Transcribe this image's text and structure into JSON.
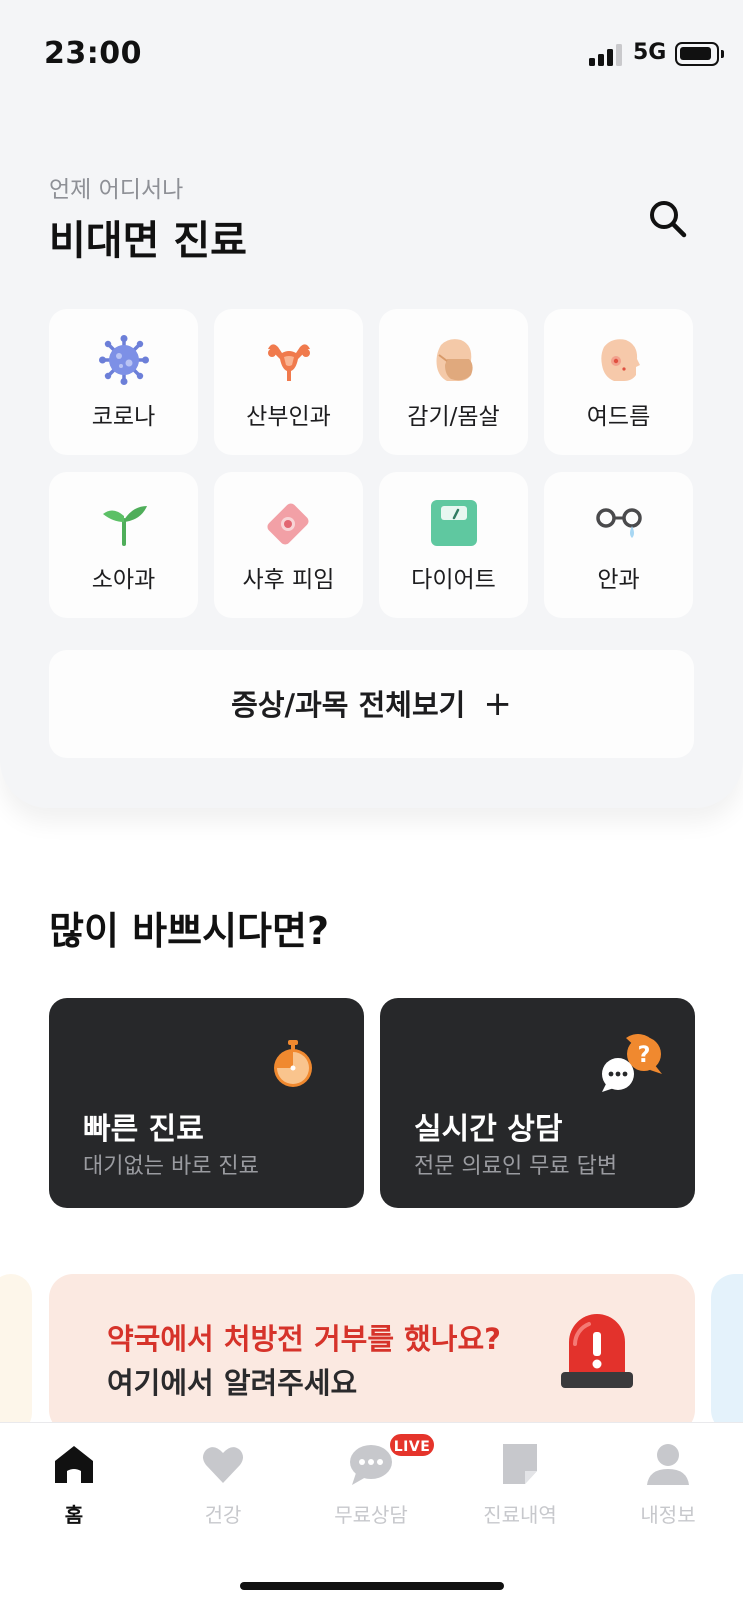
{
  "status_bar": {
    "time": "23:00",
    "network": "5G"
  },
  "header": {
    "subtitle": "언제 어디서나",
    "title": "비대면 진료"
  },
  "categories": [
    {
      "label": "코로나",
      "icon": "virus-icon"
    },
    {
      "label": "산부인과",
      "icon": "uterus-icon"
    },
    {
      "label": "감기/몸살",
      "icon": "mask-face-icon"
    },
    {
      "label": "여드름",
      "icon": "acne-face-icon"
    },
    {
      "label": "소아과",
      "icon": "sprout-icon"
    },
    {
      "label": "사후 피임",
      "icon": "pill-pack-icon"
    },
    {
      "label": "다이어트",
      "icon": "scale-icon"
    },
    {
      "label": "안과",
      "icon": "glasses-icon"
    }
  ],
  "view_all": {
    "label": "증상/과목 전체보기",
    "plus": "+"
  },
  "busy_section": {
    "title": "많이 바쁘시다면?",
    "cards": [
      {
        "title": "빠른 진료",
        "subtitle": "대기없는 바로 진료",
        "icon": "stopwatch-icon"
      },
      {
        "title": "실시간 상담",
        "subtitle": "전문 의료인 무료 답변",
        "icon": "chat-question-icon"
      }
    ]
  },
  "banner": {
    "line1": "약국에서 처방전 거부를 했나요?",
    "line2": "여기에서 알려주세요",
    "icon": "siren-icon"
  },
  "bottom_nav": {
    "items": [
      {
        "label": "홈",
        "icon": "home-icon",
        "active": true
      },
      {
        "label": "건강",
        "icon": "heart-icon",
        "active": false
      },
      {
        "label": "무료상담",
        "icon": "chat-bubble-icon",
        "active": false
      },
      {
        "label": "진료내역",
        "icon": "document-icon",
        "active": false
      },
      {
        "label": "내정보",
        "icon": "person-icon",
        "active": false
      }
    ],
    "live_badge": "LIVE"
  },
  "colors": {
    "panel_bg": "#f4f5f7",
    "dark_card": "#27282a",
    "accent_red": "#d6332a",
    "accent_orange": "#f0892f",
    "nav_inactive": "#c7c8cc"
  }
}
